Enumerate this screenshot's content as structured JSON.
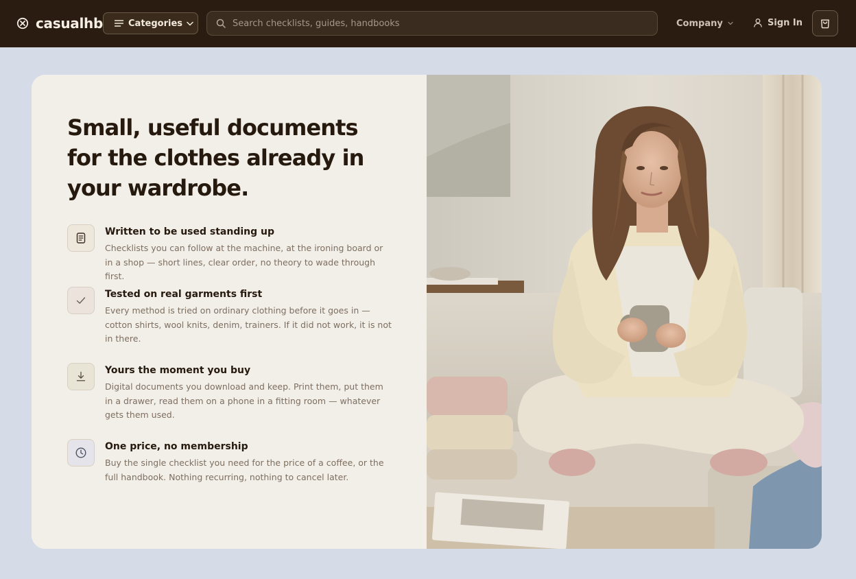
{
  "header": {
    "brand": "casualhb",
    "categories_label": "Categories",
    "search_placeholder": "Search checklists, guides, handbooks",
    "company_label": "Company",
    "signin_label": "Sign In"
  },
  "hero": {
    "headline": "Small, useful documents for the clothes already in your wardrobe.",
    "features": [
      {
        "icon": "document-icon",
        "title": "Written to be used standing up",
        "body": "Checklists you can follow at the machine, at the ironing board or in a shop — short lines, clear order, no theory to wade through first."
      },
      {
        "icon": "check-icon",
        "title": "Tested on real garments first",
        "body": "Every method is tried on ordinary clothing before it goes in — cotton shirts, wool knits, denim, trainers. If it did not work, it is not in there."
      },
      {
        "icon": "download-icon",
        "title": "Yours the moment you buy",
        "body": "Digital documents you download and keep. Print them, put them in a drawer, read them on a phone in a fitting room — whatever gets them used."
      },
      {
        "icon": "clock-icon",
        "title": "One price, no membership",
        "body": "Buy the single checklist you need for the price of a coffee, or the full handbook. Nothing recurring, nothing to cancel later."
      }
    ]
  },
  "colors": {
    "header_bg": "#2a1c10",
    "page_bg": "#d6dce7",
    "card_bg": "#f2efe9",
    "icon_bg_document": "#eee7dc",
    "icon_bg_check": "#ede3dd",
    "icon_bg_download": "#e8e4d6",
    "icon_bg_clock": "#e4e4ea"
  }
}
